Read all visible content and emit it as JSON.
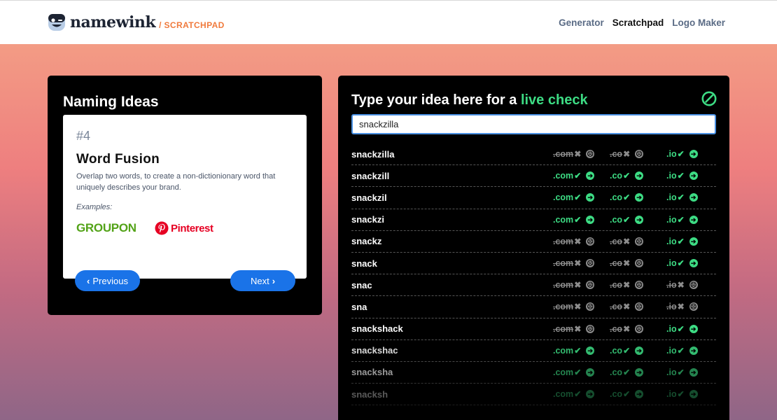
{
  "header": {
    "logo_text": "namewink",
    "logo_sub": "/ SCRATCHPAD",
    "nav": [
      {
        "label": "Generator",
        "active": false
      },
      {
        "label": "Scratchpad",
        "active": true
      },
      {
        "label": "Logo Maker",
        "active": false
      }
    ]
  },
  "ideas": {
    "title": "Naming Ideas",
    "number": "#4",
    "name": "Word Fusion",
    "description": "Overlap two words, to create a non-dictionionary word that uniquely describes your brand.",
    "examples_label": "Examples:",
    "brands": [
      "GROUPON",
      "Pinterest"
    ],
    "prev_label": "Previous",
    "next_label": "Next"
  },
  "live": {
    "title_prefix": "Type your idea here for a ",
    "title_highlight": "live check",
    "input_value": "snackzilla",
    "rows": [
      {
        "name": "snackzilla",
        "com": false,
        "co": false,
        "io": true
      },
      {
        "name": "snackzill",
        "com": true,
        "co": true,
        "io": true
      },
      {
        "name": "snackzil",
        "com": true,
        "co": true,
        "io": true
      },
      {
        "name": "snackzi",
        "com": true,
        "co": true,
        "io": true
      },
      {
        "name": "snackz",
        "com": false,
        "co": false,
        "io": true
      },
      {
        "name": "snack",
        "com": false,
        "co": false,
        "io": true
      },
      {
        "name": "snac",
        "com": false,
        "co": false,
        "io": false
      },
      {
        "name": "sna",
        "com": false,
        "co": false,
        "io": false
      },
      {
        "name": "snackshack",
        "com": false,
        "co": false,
        "io": true
      },
      {
        "name": "snackshac",
        "com": true,
        "co": true,
        "io": true
      },
      {
        "name": "snacksha",
        "com": true,
        "co": true,
        "io": true
      },
      {
        "name": "snacksh",
        "com": true,
        "co": true,
        "io": true
      }
    ],
    "tlds": [
      ".com",
      ".co",
      ".io"
    ]
  },
  "colors": {
    "available": "#3ddc84",
    "taken": "#8c8c8c",
    "button": "#1a73e8",
    "accent": "#f07a3c"
  }
}
